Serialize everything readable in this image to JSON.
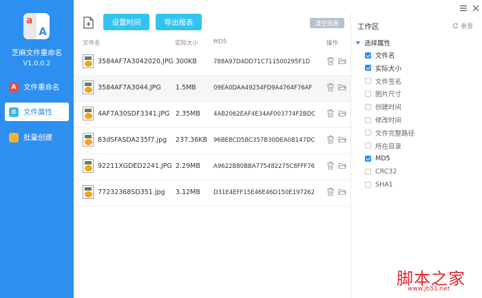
{
  "app": {
    "title": "芝麻文件重命名",
    "version": "V1.0.0.2"
  },
  "nav": [
    {
      "label": "文件重命名",
      "icon": "rename-icon",
      "active": false
    },
    {
      "label": "文件属性",
      "icon": "file-attr-icon",
      "active": true
    },
    {
      "label": "批量创建",
      "icon": "folder-icon",
      "active": false
    }
  ],
  "toolbar": {
    "set_time": "设置时间",
    "export_report": "导出报表",
    "clear_list": "清空列表"
  },
  "table": {
    "headers": {
      "name": "文件名",
      "size": "实际大小",
      "md5": "MD5",
      "actions": "操作"
    },
    "rows": [
      {
        "name": "3584AF7A3042020.JPG",
        "size": "300KB",
        "md5": "788A97D4DD71C711500295F1D"
      },
      {
        "name": "3584AF7A3044.JPG",
        "size": "1.5MB",
        "md5": "09EA0DAA49254FD9A4764F76AF"
      },
      {
        "name": "4AF7A30SDF3341.JPG",
        "size": "2.35MB",
        "md5": "4AB2062EAF4E34AF003774F2BDC"
      },
      {
        "name": "83dSFASDA235f7.jpg",
        "size": "237.36KB",
        "md5": "96BE8CD5BC357B30DEA0B147DC"
      },
      {
        "name": "92211XGDED2241.JPG",
        "size": "2.29MB",
        "md5": "A9622B80BBA775482275C8FFF76"
      },
      {
        "name": "77232368SD351.jpg",
        "size": "3.12MB",
        "md5": "D31E4EFF15E46E46D150E197262"
      }
    ]
  },
  "workspace": {
    "title": "工作区",
    "reset": "重置",
    "group": "选择属性",
    "attributes": [
      {
        "label": "文件名",
        "checked": true
      },
      {
        "label": "实际大小",
        "checked": true
      },
      {
        "label": "文件签名",
        "checked": false
      },
      {
        "label": "图片尺寸",
        "checked": false
      },
      {
        "label": "创建时间",
        "checked": false
      },
      {
        "label": "修改时间",
        "checked": false
      },
      {
        "label": "文件完整路径",
        "checked": false
      },
      {
        "label": "所在目录",
        "checked": false
      },
      {
        "label": "MD5",
        "checked": true
      },
      {
        "label": "CRC32",
        "checked": false
      },
      {
        "label": "SHA1",
        "checked": false
      }
    ]
  },
  "watermark": {
    "cn": "脚本之家",
    "url": "www.jb51.net"
  },
  "colors": {
    "accent": "#2d8ff0",
    "button": "#33c3f0",
    "watermark": "#e2272d"
  }
}
